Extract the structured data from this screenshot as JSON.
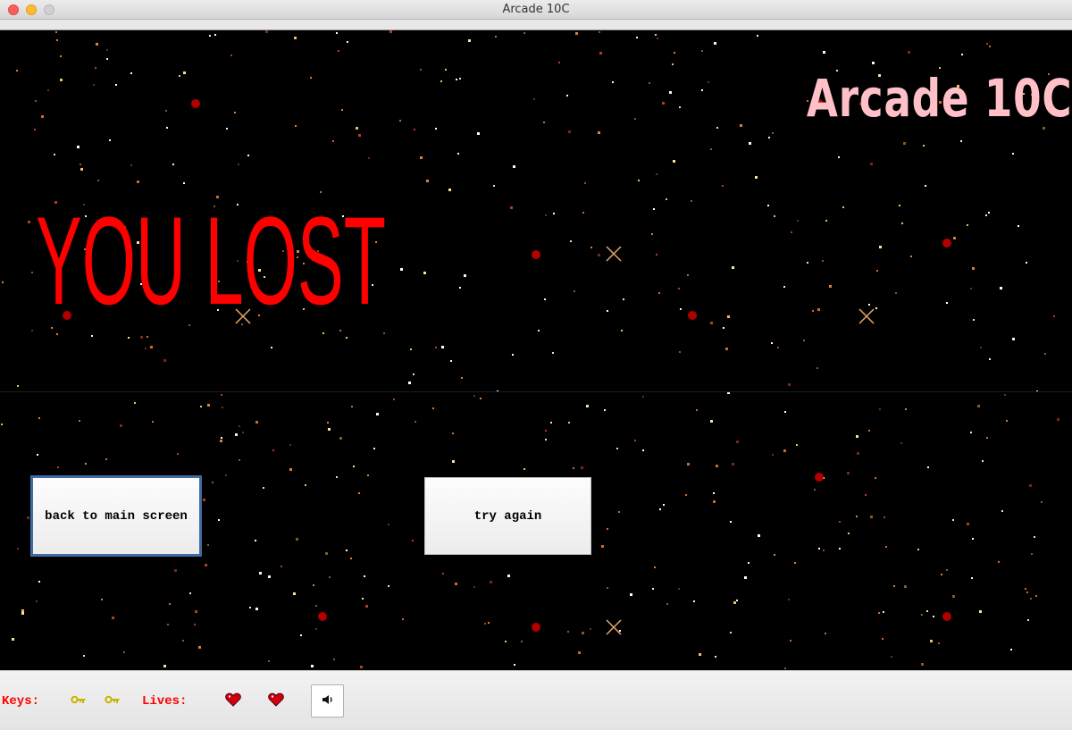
{
  "window": {
    "title": "Arcade 10C"
  },
  "game": {
    "logo": "Arcade 10C",
    "message": "YOU LOST",
    "message_color": "#ff0000",
    "logo_color": "#ffc0c8"
  },
  "buttons": {
    "back_label": "back to main screen",
    "retry_label": "try again"
  },
  "status": {
    "keys_label": "Keys:",
    "lives_label": "Lives:",
    "keys_count": 2,
    "lives_count": 2,
    "key_icon": "key-icon",
    "life_icon": "heart-icon",
    "sound_icon": "speaker-icon",
    "label_color": "#ff0000"
  }
}
